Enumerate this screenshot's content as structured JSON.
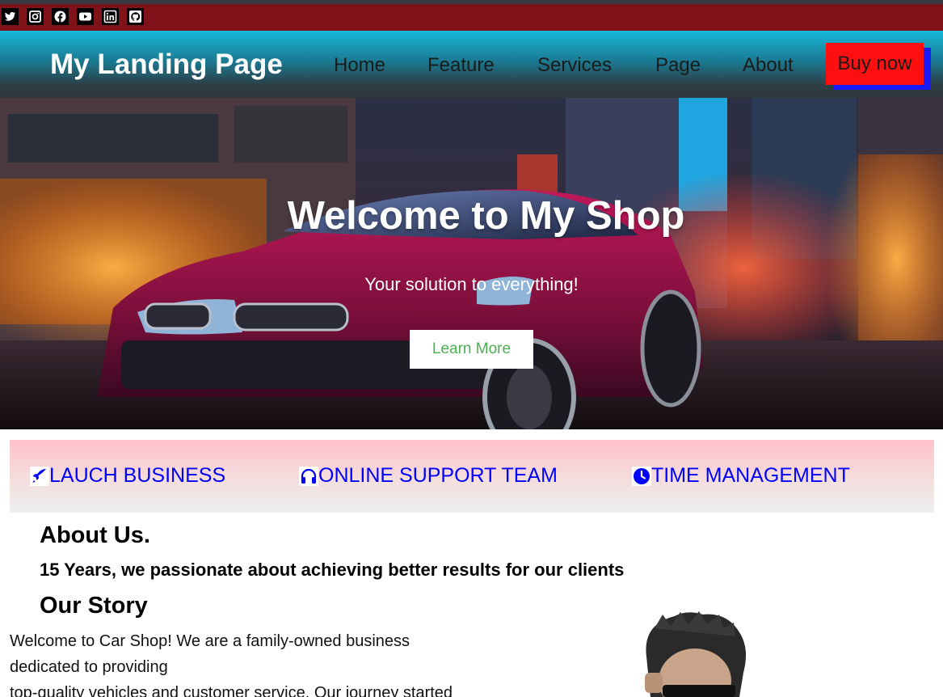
{
  "social": {
    "icons": [
      "twitter-icon",
      "instagram-icon",
      "facebook-icon",
      "youtube-icon",
      "linkedin-icon",
      "github-icon"
    ]
  },
  "nav": {
    "brand": "My Landing Page",
    "links": [
      "Home",
      "Feature",
      "Services",
      "Page",
      "About"
    ],
    "buy_label": "Buy now"
  },
  "hero": {
    "title": "Welcome to My Shop",
    "subtitle": "Your solution to everything!",
    "button_label": "Learn More"
  },
  "features": [
    {
      "icon": "rocket-icon",
      "label": "LAUCH BUSINESS"
    },
    {
      "icon": "headphones-icon",
      "label": "ONLINE SUPPORT TEAM"
    },
    {
      "icon": "clock-icon",
      "label": "TIME MANAGEMENT"
    }
  ],
  "about": {
    "heading": "About Us.",
    "subheading": "15 Years, we passionate about achieving better results for our clients",
    "story_heading": "Our Story",
    "story_lines": [
      "Welcome to Car Shop! We are a family-owned business",
      "dedicated to providing",
      "top-quality vehicles and customer service. Our journey started"
    ]
  },
  "colors": {
    "topbar": "#80121a",
    "buy_button": "#ff0f0f",
    "buy_shadow": "#1a1aff",
    "feature_text": "#0000ff",
    "learn_more_text": "#4caf50"
  }
}
